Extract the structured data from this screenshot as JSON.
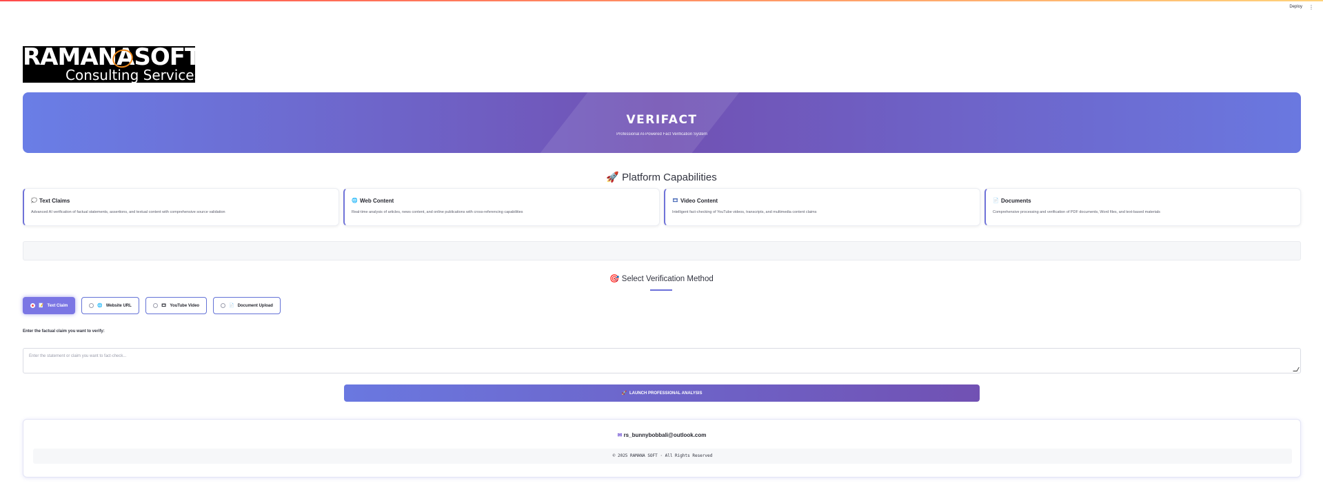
{
  "app": {
    "deploy_label": "Deploy",
    "menu_icon": "kebab-menu-icon"
  },
  "logo": {
    "line1": "RAMANASOFT",
    "line2": "Consulting Services"
  },
  "hero": {
    "title": "VERIFACT",
    "subtitle": "Professional AI-Powered Fact Verification System"
  },
  "capabilities": {
    "title": "Platform Capabilities",
    "icon": "rocket-icon",
    "cards": [
      {
        "icon": "speech-bubble-icon",
        "title": "Text Claims",
        "desc": "Advanced AI verification of factual statements, assertions, and textual content with comprehensive source validation"
      },
      {
        "icon": "globe-icon",
        "title": "Web Content",
        "desc": "Real-time analysis of articles, news content, and online publications with cross-referencing capabilities"
      },
      {
        "icon": "film-icon",
        "title": "Video Content",
        "desc": "Intelligent fact-checking of YouTube videos, transcripts, and multimedia content claims"
      },
      {
        "icon": "document-icon",
        "title": "Documents",
        "desc": "Comprehensive processing and verification of PDF documents, Word files, and text-based materials"
      }
    ]
  },
  "method": {
    "title": "Select Verification Method",
    "icon": "target-icon",
    "options": [
      {
        "icon": "memo-icon",
        "label": "Text Claim",
        "selected": true
      },
      {
        "icon": "globe-icon",
        "label": "Website URL",
        "selected": false
      },
      {
        "icon": "film-icon",
        "label": "YouTube Video",
        "selected": false
      },
      {
        "icon": "document-icon",
        "label": "Document Upload",
        "selected": false
      }
    ]
  },
  "input": {
    "label": "Enter the factual claim you want to verify:",
    "placeholder": "Enter the statement or claim you want to fact-check..."
  },
  "launch": {
    "label": "LAUNCH PROFESSIONAL ANALYSIS",
    "icon": "rocket-icon"
  },
  "footer": {
    "icon": "email-icon",
    "email": "rs_bunnybobbali@outlook.com",
    "copyright": "© 2025 RAMANA SOFT · All Rights Reserved"
  },
  "colors": {
    "accent": "#6a78e0",
    "accent_dark": "#7151b3",
    "active_radio": "#ff4b4b"
  }
}
